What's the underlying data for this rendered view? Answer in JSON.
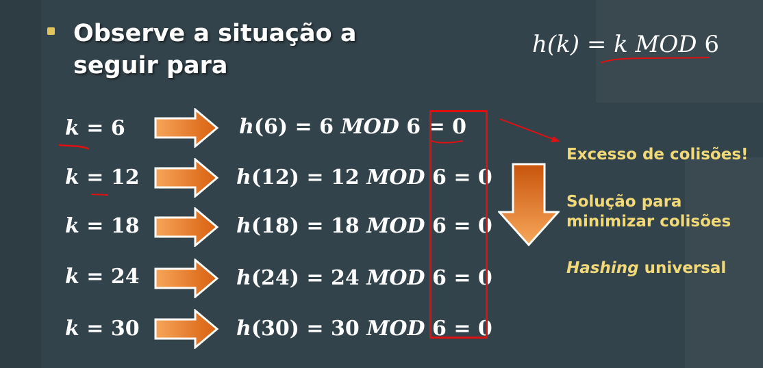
{
  "slide": {
    "title_line1": "Observe a situação a",
    "title_line2": "seguir para",
    "hash_function": {
      "lhs": "h(k)",
      "eq": " = ",
      "k": "k",
      "op": " MOD ",
      "n": "6"
    },
    "rows": [
      {
        "k_label": "k",
        "k_value": "6",
        "h_label": "h",
        "h_arg": "(6)",
        "rhs_num": "6",
        "op": "MOD",
        "mod": "6",
        "result": "0"
      },
      {
        "k_label": "k",
        "k_value": "12",
        "h_label": "h",
        "h_arg": "(12)",
        "rhs_num": "12",
        "op": "MOD",
        "mod": "6",
        "result": "0"
      },
      {
        "k_label": "k",
        "k_value": "18",
        "h_label": "h",
        "h_arg": "(18)",
        "rhs_num": "18",
        "op": "MOD",
        "mod": "6",
        "result": "0"
      },
      {
        "k_label": "k",
        "k_value": "24",
        "h_label": "h",
        "h_arg": "(24)",
        "rhs_num": "24",
        "op": "MOD",
        "mod": "6",
        "result": "0"
      },
      {
        "k_label": "k",
        "k_value": "30",
        "h_label": "h",
        "h_arg": "(30)",
        "rhs_num": "30",
        "op": "MOD",
        "mod": "6",
        "result": "0"
      }
    ],
    "notes": {
      "collisions": "Excesso de colisões!",
      "solution_line1": "Solução para",
      "solution_line2": "minimizar colisões",
      "hashing_word": "Hashing",
      "universal_word": " universal"
    },
    "colors": {
      "background": "#33434b",
      "accent_yellow": "#f1d978",
      "arrow_orange": "#e8731a",
      "annotation_red": "#e01010"
    }
  }
}
